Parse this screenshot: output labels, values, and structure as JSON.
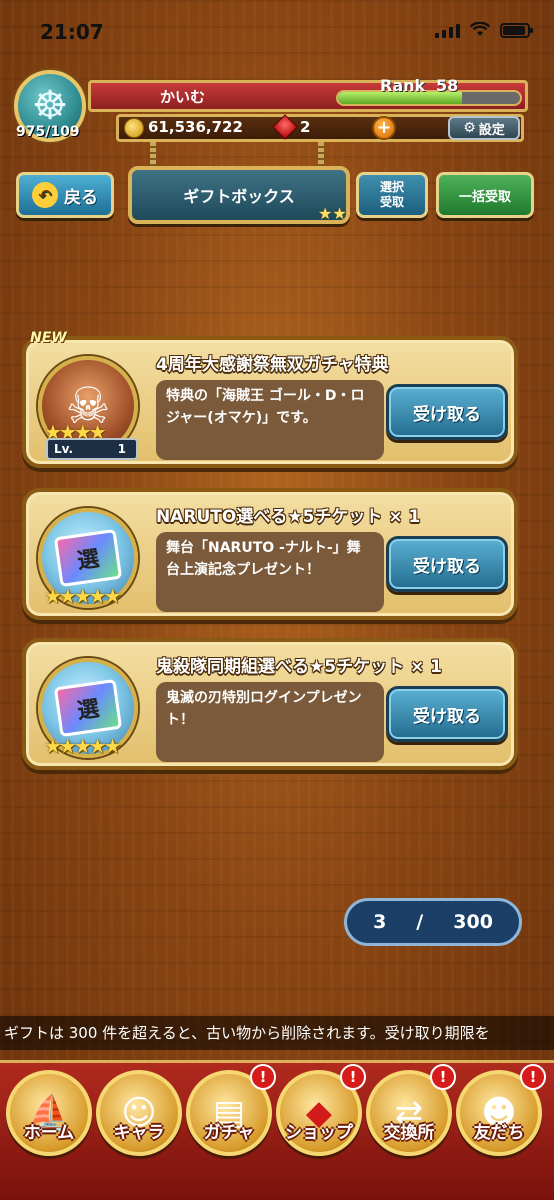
{
  "status_bar": {
    "time": "21:07"
  },
  "player": {
    "name": "かいむ",
    "stamina": "975/109",
    "rank_label": "Rank",
    "rank": "58",
    "rank_progress": 0.68,
    "coins": "61,536,722",
    "gems": "2",
    "plus_label": "+",
    "settings_label": "設定"
  },
  "nav": {
    "back_label": "戻る",
    "title": "ギフトボックス",
    "select_line1": "選択",
    "select_line2": "受取",
    "bulk_label": "一括受取"
  },
  "gifts": [
    {
      "tag": "NEW",
      "title": "4周年大感謝祭無双ガチャ特典",
      "description": "特典の「海賊王 ゴール・D・ロジャー(オマケ)」です。",
      "level_label": "Lv.",
      "level": "1",
      "stars": 4,
      "icon": "pirate-character-icon",
      "button": "受け取る"
    },
    {
      "title": "NARUTO選べる★5チケット × 1",
      "description": "舞台「NARUTO -ナルト-」舞台上演記念プレゼント！",
      "stars": 5,
      "icon": "ticket-icon",
      "ticket_glyph": "選",
      "button": "受け取る"
    },
    {
      "title": "鬼殺隊同期組選べる★5チケット × 1",
      "description": "鬼滅の刃特別ログインプレゼント！",
      "stars": 5,
      "icon": "ticket-icon",
      "ticket_glyph": "選",
      "button": "受け取る"
    }
  ],
  "pagination": {
    "current": "3",
    "separator": "/",
    "total": "300"
  },
  "ticker": "ギフトは 300 件を超えると、古い物から削除されます。受け取り期限を",
  "bottom_nav": [
    {
      "label": "ホーム",
      "icon": "ship-icon",
      "badge": ""
    },
    {
      "label": "キャラ",
      "icon": "character-icon",
      "badge": ""
    },
    {
      "label": "ガチャ",
      "icon": "gacha-book-icon",
      "badge": "!"
    },
    {
      "label": "ショップ",
      "icon": "gem-icon",
      "badge": "!"
    },
    {
      "label": "交換所",
      "icon": "trade-icon",
      "badge": "!"
    },
    {
      "label": "友だち",
      "icon": "friends-icon",
      "badge": "!"
    }
  ],
  "colors": {
    "wood": "#8a4614",
    "gold_border": "#d9b25a",
    "receive_button": "#226c8e",
    "nav_red": "#b02a1e"
  }
}
